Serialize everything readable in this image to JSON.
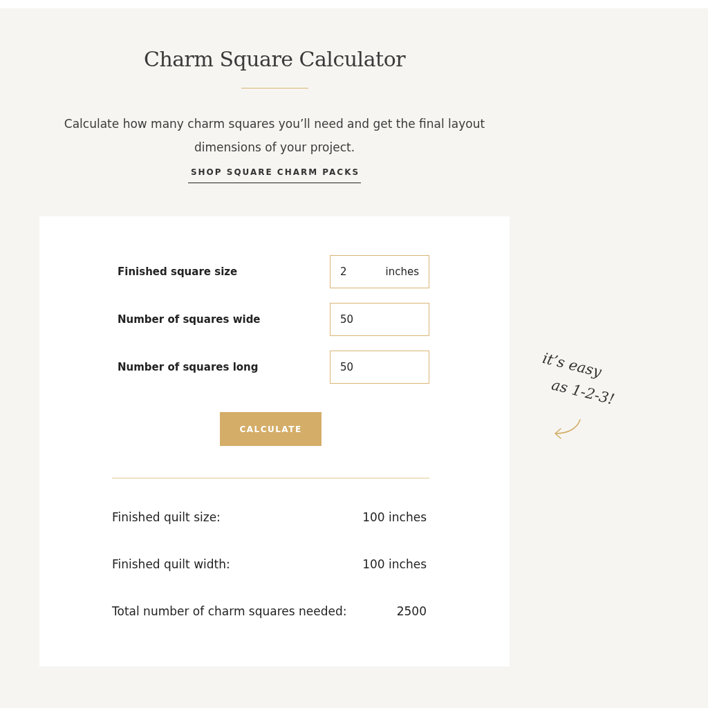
{
  "header": {
    "title": "Charm Square Calculator",
    "description": "Calculate how many charm squares you’ll need and get the final layout dimensions of your project.",
    "link": "SHOP SQUARE CHARM PACKS"
  },
  "form": {
    "fields": [
      {
        "label": "Finished square size",
        "value": "2",
        "unit": "inches"
      },
      {
        "label": "Number of squares wide",
        "value": "50"
      },
      {
        "label": "Number of squares long",
        "value": "50"
      }
    ],
    "button": "CALCULATE"
  },
  "results": [
    {
      "label": "Finished quilt size:",
      "value": "100 inches"
    },
    {
      "label": "Finished quilt width:",
      "value": "100 inches"
    },
    {
      "label": "Total number of charm squares needed:",
      "value": "2500"
    }
  ],
  "note": {
    "lines": [
      "it’s easy",
      "as 1-2-3!"
    ]
  }
}
